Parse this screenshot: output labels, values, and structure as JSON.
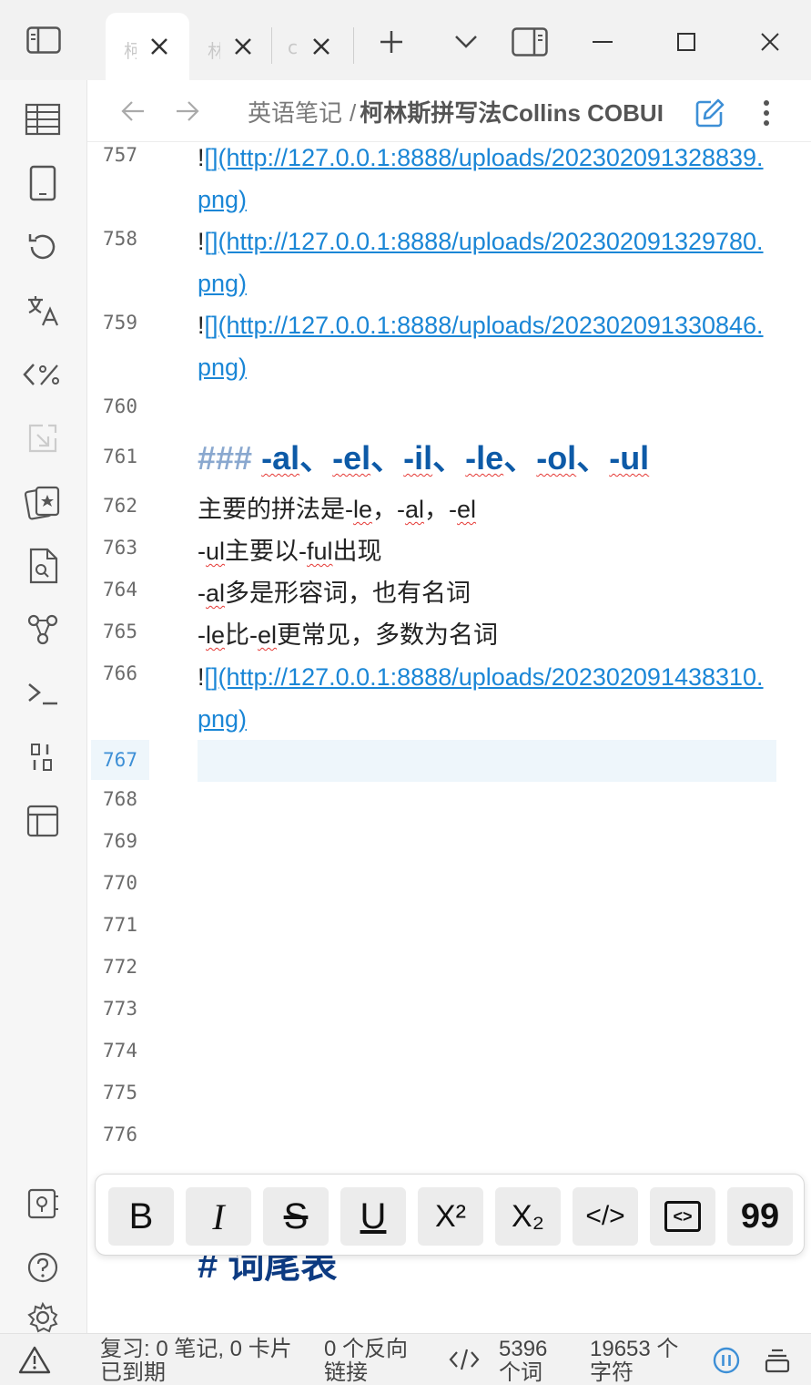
{
  "tabs": [
    {
      "label": "柯"
    },
    {
      "label": "林"
    },
    {
      "label": "c"
    }
  ],
  "breadcrumb": {
    "parent": "英语笔记",
    "separator": "/",
    "title": "柯林斯拼写法Collins COBUILD"
  },
  "lines": [
    {
      "num": "757",
      "prefix": "!",
      "link": "[](http://127.0.0.1:8888/uploads/202302091328839.png)"
    },
    {
      "num": "758",
      "prefix": "!",
      "link": "[](http://127.0.0.1:8888/uploads/202302091329780.png)"
    },
    {
      "num": "759",
      "prefix": "!",
      "link": "[](http://127.0.0.1:8888/uploads/202302091330846.png)"
    },
    {
      "num": "760"
    },
    {
      "num": "761",
      "hash": "###",
      "h_al": "-al",
      "sep": "、",
      "h_el": "-el",
      "h_il": "-il",
      "h_le": "-le",
      "h_ol": "-ol",
      "h_ul": "-ul"
    },
    {
      "num": "762",
      "t1": "主要的拼法是-",
      "t2": "le",
      "t3": "，-",
      "t4": "al",
      "t5": "，-",
      "t6": "el"
    },
    {
      "num": "763",
      "t1": "-",
      "t2": "ul",
      "t3": "主要以-",
      "t4": "ful",
      "t5": "出现"
    },
    {
      "num": "764",
      "t1": "-",
      "t2": "al",
      "t3": "多是形容词，也有名词"
    },
    {
      "num": "765",
      "t1": "-",
      "t2": "le",
      "t3": "比-",
      "t4": "el",
      "t5": "更常见，多数为名词"
    },
    {
      "num": "766",
      "prefix": "!",
      "link": "[](http://127.0.0.1:8888/uploads/202302091438310.png)"
    },
    {
      "num": "767"
    },
    {
      "num": "768"
    },
    {
      "num": "769"
    },
    {
      "num": "770"
    },
    {
      "num": "771"
    },
    {
      "num": "772"
    },
    {
      "num": "773"
    },
    {
      "num": "774"
    },
    {
      "num": "775"
    },
    {
      "num": "776"
    }
  ],
  "overflow_heading": "# 词尾表",
  "format_toolbar": {
    "bold": "B",
    "italic": "I",
    "strike": "S",
    "underline": "U",
    "superscript": "X²",
    "subscript": "X₂",
    "code": "</>",
    "codeblock": "<>",
    "quote": "99"
  },
  "status": {
    "review": "复习: 0 笔记, 0 卡片已到期",
    "backlinks": "0 个反向链接",
    "words": "5396 个词",
    "chars": "19653 个字符"
  },
  "colors": {
    "link": "#1a86d6",
    "heading": "#0d5aa7",
    "accent": "#3d8fd6",
    "squiggle": "#e53935"
  }
}
